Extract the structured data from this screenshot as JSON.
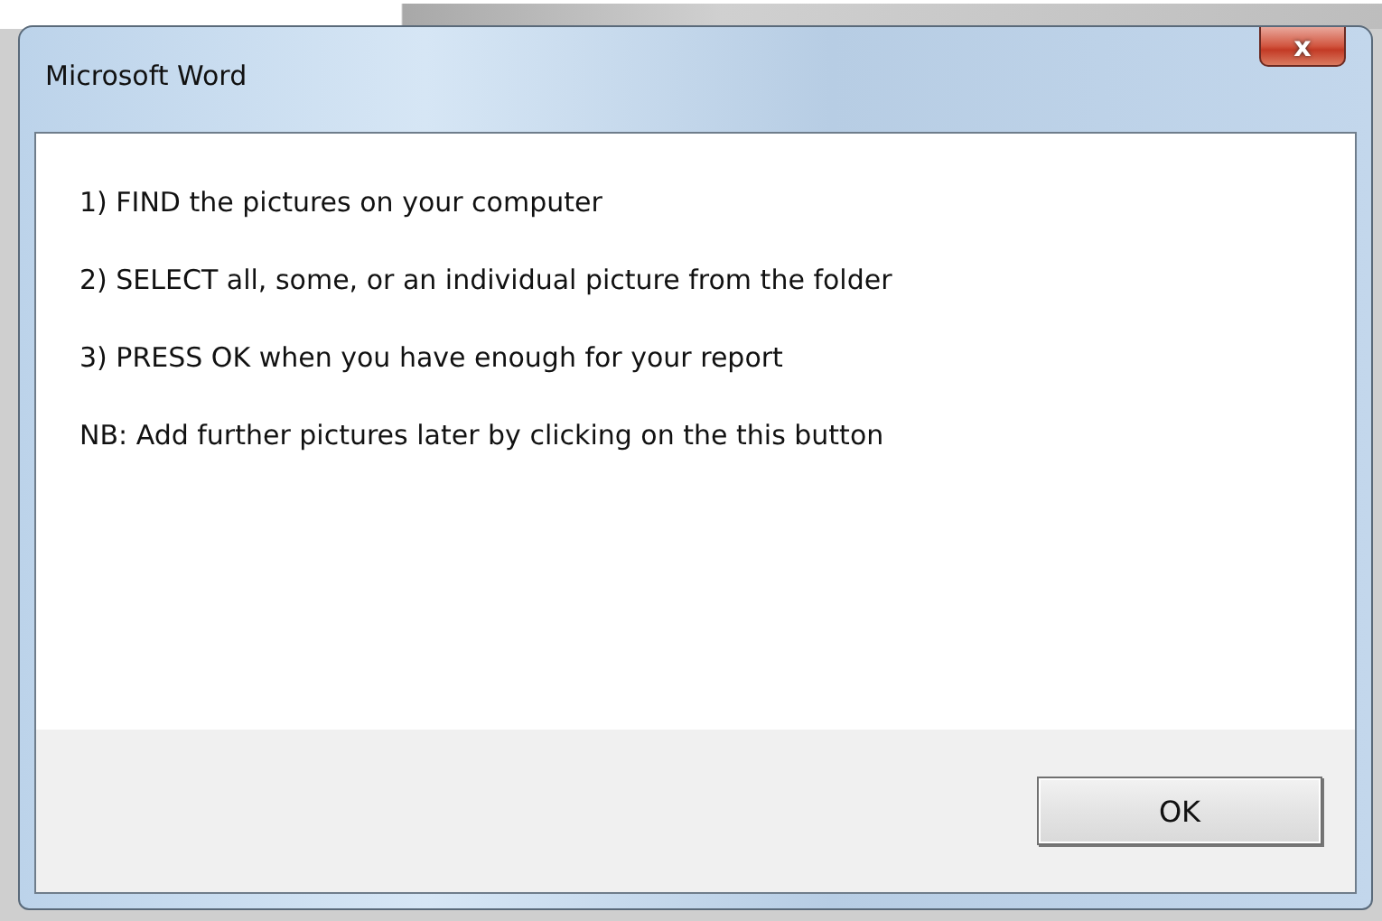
{
  "window": {
    "title": "Microsoft Word",
    "close": "x"
  },
  "lines": [
    "1) FIND the pictures on your computer",
    "2) SELECT all, some, or an individual picture from the folder",
    "3) PRESS OK when you have enough for your report",
    "NB: Add further pictures later by clicking on the this button"
  ],
  "buttons": [
    "OK"
  ]
}
